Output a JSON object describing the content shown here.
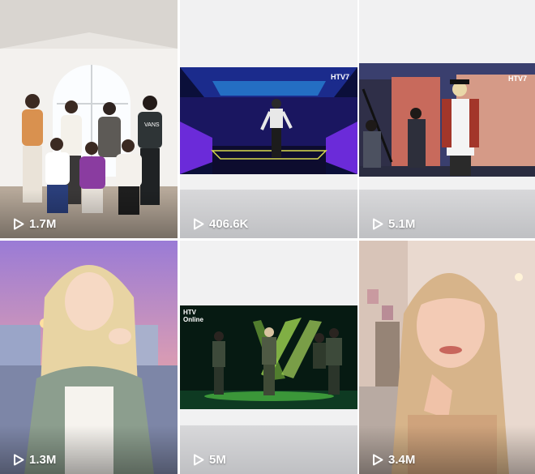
{
  "videos": [
    {
      "views": "1.7M"
    },
    {
      "views": "406.6K"
    },
    {
      "views": "5.1M"
    },
    {
      "views": "1.3M"
    },
    {
      "views": "5M"
    },
    {
      "views": "3.4M"
    }
  ],
  "overlays": {
    "htv7_a": "HTV7",
    "htv7_b": "HTV7",
    "htv_online": "HTV Online",
    "shirt_text": "VANS"
  },
  "colors": {
    "selected_outline": "#e21b1b",
    "tile_background": "#f1f1f2"
  }
}
